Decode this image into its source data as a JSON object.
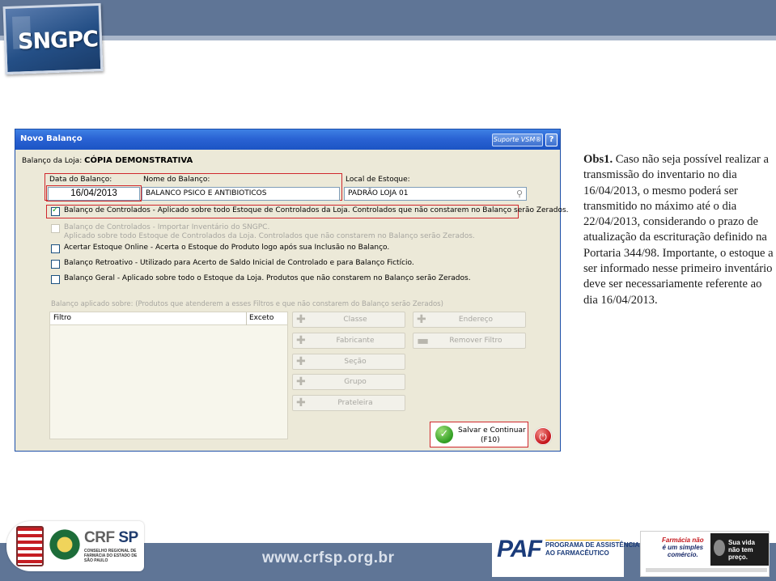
{
  "header": {
    "logo_text": "SNGPC"
  },
  "window": {
    "title": "Novo Balanço",
    "support_button": "Suporte VSM®",
    "help_button": "?",
    "store_label": "Balanço da Loja:",
    "store_name": "CÓPIA DEMONSTRATIVA",
    "date_label": "Data do Balanço:",
    "date_value": "16/04/2013",
    "name_label": "Nome do Balanço:",
    "name_value": "BALANCO PSICO E ANTIBIOTICOS",
    "stock_label": "Local de Estoque:",
    "stock_value": "PADRÃO LOJA 01",
    "options": [
      {
        "label": "Balanço de Controlados - Aplicado sobre todo Estoque de Controlados da Loja. Controlados que não constarem no Balanço serão Zerados.",
        "checked": true,
        "disabled": false
      },
      {
        "label": "Balanço de Controlados - Importar Inventário do SNGPC.",
        "sub": "Aplicado sobre todo Estoque de Controlados da Loja. Controlados que não constarem no Balanço serão Zerados.",
        "checked": false,
        "disabled": true
      },
      {
        "label": "Acertar Estoque Online - Acerta o Estoque do Produto logo após sua Inclusão no Balanço.",
        "checked": false,
        "disabled": false
      },
      {
        "label": "Balanço Retroativo - Utilizado para Acerto de Saldo Inicial de Controlado e para Balanço Fictício.",
        "checked": false,
        "disabled": false
      },
      {
        "label": "Balanço Geral - Aplicado sobre todo o Estoque da Loja. Produtos que não constarem no Balanço serão Zerados.",
        "checked": false,
        "disabled": false
      }
    ],
    "filter_caption": "Balanço aplicado sobre: (Produtos que atenderem a esses Filtros e que não constarem do Balanço serão Zerados)",
    "filter_col_filtro": "Filtro",
    "filter_col_exceto": "Exceto",
    "filter_buttons": {
      "classe": "Classe",
      "endereco": "Endereço",
      "fabricante": "Fabricante",
      "remover": "Remover Filtro",
      "secao": "Seção",
      "grupo": "Grupo",
      "prateleira": "Prateleira"
    },
    "save_label": "Salvar e Continuar",
    "save_key": "(F10)"
  },
  "note": {
    "prefix": "Obs1.",
    "text": "Caso não seja possível realizar a transmissão do inventario no dia 16/04/2013, o mesmo poderá ser transmitido no máximo até o dia 22/04/2013, considerando o prazo de atualização da escrituração definido na Portaria 344/98. Importante, o estoque a ser informado nesse primeiro inventário deve ser necessariamente referente ao dia 16/04/2013."
  },
  "footer": {
    "crf_name": "CRF",
    "crf_state": "SP",
    "crf_sub": "CONSELHO REGIONAL DE FARMÁCIA DO ESTADO DE SÃO PAULO",
    "url": "www.crfsp.org.br",
    "paf_mark": "PAF",
    "paf_line1": "PROGRAMA DE ASSISTÊNCIA",
    "paf_line2": "AO FARMACÊUTICO",
    "campaign_line1": "Farmácia não",
    "campaign_line2": "é um simples",
    "campaign_line3": "comércio.",
    "campaign_right1": "Sua vida",
    "campaign_right2": "não tem",
    "campaign_right3": "preço."
  },
  "colors": {
    "header_band": "#5f7596",
    "titlebar": "#2a63d4",
    "highlight_red": "#d0282d",
    "window_bg": "#ece9d8"
  },
  "icons": {
    "search": "search-icon",
    "add": "plus-icon",
    "remove": "minus-icon",
    "save": "check-icon",
    "close": "power-icon"
  }
}
